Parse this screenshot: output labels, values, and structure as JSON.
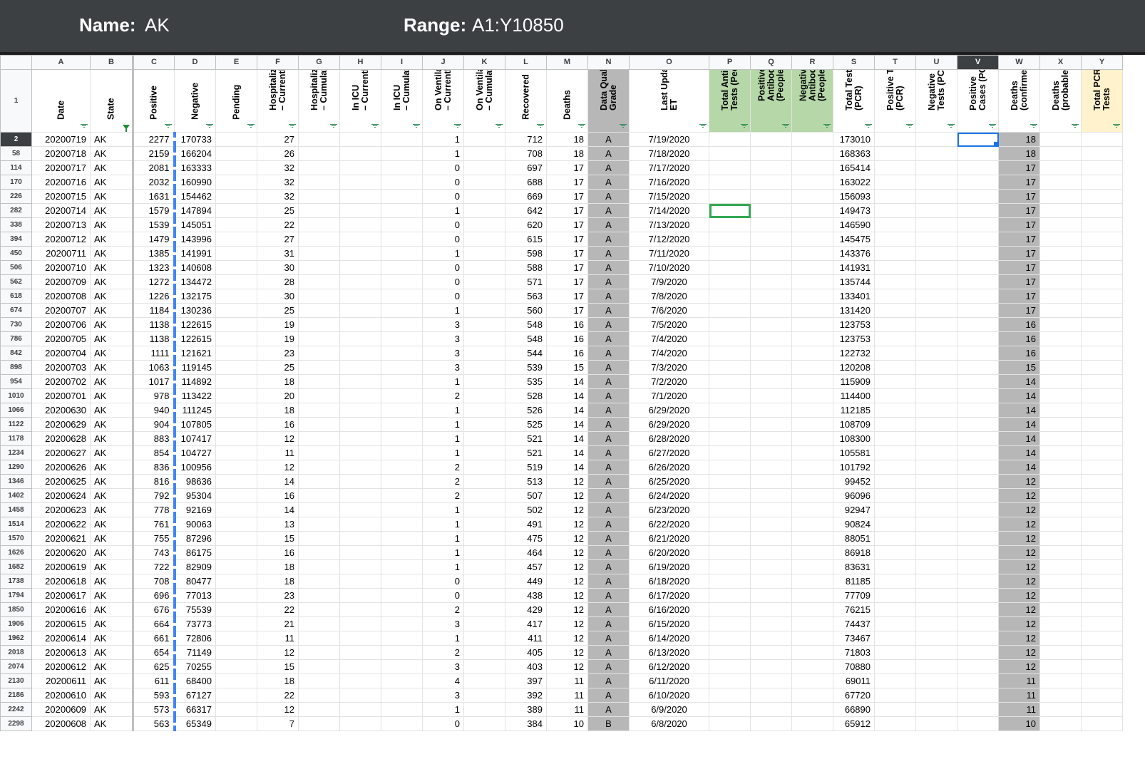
{
  "topbar": {
    "name_label": "Name:",
    "name_value": "AK",
    "range_label": "Range:",
    "range_value": "A1:Y10850"
  },
  "columns": [
    "A",
    "B",
    "C",
    "D",
    "E",
    "F",
    "G",
    "H",
    "I",
    "J",
    "K",
    "L",
    "M",
    "N",
    "O",
    "P",
    "Q",
    "R",
    "S",
    "T",
    "U",
    "V",
    "W",
    "X",
    "Y"
  ],
  "headers": [
    "Date",
    "State",
    "Positive",
    "Negative",
    "Pending",
    "Hospitalized\n– Currently",
    "Hospitalized\n– Cumulative",
    "In ICU\n– Currently",
    "In ICU\n– Cumulative",
    "On Ventilator\n– Currently",
    "On Ventilator\n– Cumulative",
    "Recovered",
    "Deaths",
    "Data Quality\nGrade",
    "Last Update\nET",
    "Total Antibody\nTests (People)",
    "Positive\nAntibody Tests\n(People)",
    "Negative\nAntibody Tests\n(People)",
    "Total Tests\n(PCR)",
    "Positive Tests\n(PCR)",
    "Negative\nTests (PCR)",
    "Positive\nCases (PCR)",
    "Deaths\n(confirmed)",
    "Deaths\n(probable)",
    "Total PCR\nTests"
  ],
  "header_row_number": "1",
  "rows": [
    {
      "n": "2",
      "date": "20200719",
      "state": "AK",
      "pos": "2277",
      "neg": "170733",
      "hosp": "27",
      "vent": "1",
      "rec": "712",
      "deaths": "18",
      "grade": "A",
      "upd": "7/19/2020",
      "tt": "173010",
      "dc": "18"
    },
    {
      "n": "58",
      "date": "20200718",
      "state": "AK",
      "pos": "2159",
      "neg": "166204",
      "hosp": "26",
      "vent": "1",
      "rec": "708",
      "deaths": "18",
      "grade": "A",
      "upd": "7/18/2020",
      "tt": "168363",
      "dc": "18"
    },
    {
      "n": "114",
      "date": "20200717",
      "state": "AK",
      "pos": "2081",
      "neg": "163333",
      "hosp": "32",
      "vent": "0",
      "rec": "697",
      "deaths": "17",
      "grade": "A",
      "upd": "7/17/2020",
      "tt": "165414",
      "dc": "17"
    },
    {
      "n": "170",
      "date": "20200716",
      "state": "AK",
      "pos": "2032",
      "neg": "160990",
      "hosp": "32",
      "vent": "0",
      "rec": "688",
      "deaths": "17",
      "grade": "A",
      "upd": "7/16/2020",
      "tt": "163022",
      "dc": "17"
    },
    {
      "n": "226",
      "date": "20200715",
      "state": "AK",
      "pos": "1631",
      "neg": "154462",
      "hosp": "32",
      "vent": "0",
      "rec": "669",
      "deaths": "17",
      "grade": "A",
      "upd": "7/15/2020",
      "tt": "156093",
      "dc": "17"
    },
    {
      "n": "282",
      "date": "20200714",
      "state": "AK",
      "pos": "1579",
      "neg": "147894",
      "hosp": "25",
      "vent": "1",
      "rec": "642",
      "deaths": "17",
      "grade": "A",
      "upd": "7/14/2020",
      "tt": "149473",
      "dc": "17"
    },
    {
      "n": "338",
      "date": "20200713",
      "state": "AK",
      "pos": "1539",
      "neg": "145051",
      "hosp": "22",
      "vent": "0",
      "rec": "620",
      "deaths": "17",
      "grade": "A",
      "upd": "7/13/2020",
      "tt": "146590",
      "dc": "17"
    },
    {
      "n": "394",
      "date": "20200712",
      "state": "AK",
      "pos": "1479",
      "neg": "143996",
      "hosp": "27",
      "vent": "0",
      "rec": "615",
      "deaths": "17",
      "grade": "A",
      "upd": "7/12/2020",
      "tt": "145475",
      "dc": "17"
    },
    {
      "n": "450",
      "date": "20200711",
      "state": "AK",
      "pos": "1385",
      "neg": "141991",
      "hosp": "31",
      "vent": "1",
      "rec": "598",
      "deaths": "17",
      "grade": "A",
      "upd": "7/11/2020",
      "tt": "143376",
      "dc": "17"
    },
    {
      "n": "506",
      "date": "20200710",
      "state": "AK",
      "pos": "1323",
      "neg": "140608",
      "hosp": "30",
      "vent": "0",
      "rec": "588",
      "deaths": "17",
      "grade": "A",
      "upd": "7/10/2020",
      "tt": "141931",
      "dc": "17"
    },
    {
      "n": "562",
      "date": "20200709",
      "state": "AK",
      "pos": "1272",
      "neg": "134472",
      "hosp": "28",
      "vent": "0",
      "rec": "571",
      "deaths": "17",
      "grade": "A",
      "upd": "7/9/2020",
      "tt": "135744",
      "dc": "17"
    },
    {
      "n": "618",
      "date": "20200708",
      "state": "AK",
      "pos": "1226",
      "neg": "132175",
      "hosp": "30",
      "vent": "0",
      "rec": "563",
      "deaths": "17",
      "grade": "A",
      "upd": "7/8/2020",
      "tt": "133401",
      "dc": "17"
    },
    {
      "n": "674",
      "date": "20200707",
      "state": "AK",
      "pos": "1184",
      "neg": "130236",
      "hosp": "25",
      "vent": "1",
      "rec": "560",
      "deaths": "17",
      "grade": "A",
      "upd": "7/6/2020",
      "tt": "131420",
      "dc": "17"
    },
    {
      "n": "730",
      "date": "20200706",
      "state": "AK",
      "pos": "1138",
      "neg": "122615",
      "hosp": "19",
      "vent": "3",
      "rec": "548",
      "deaths": "16",
      "grade": "A",
      "upd": "7/5/2020",
      "tt": "123753",
      "dc": "16"
    },
    {
      "n": "786",
      "date": "20200705",
      "state": "AK",
      "pos": "1138",
      "neg": "122615",
      "hosp": "19",
      "vent": "3",
      "rec": "548",
      "deaths": "16",
      "grade": "A",
      "upd": "7/4/2020",
      "tt": "123753",
      "dc": "16"
    },
    {
      "n": "842",
      "date": "20200704",
      "state": "AK",
      "pos": "1111",
      "neg": "121621",
      "hosp": "23",
      "vent": "3",
      "rec": "544",
      "deaths": "16",
      "grade": "A",
      "upd": "7/4/2020",
      "tt": "122732",
      "dc": "16"
    },
    {
      "n": "898",
      "date": "20200703",
      "state": "AK",
      "pos": "1063",
      "neg": "119145",
      "hosp": "25",
      "vent": "3",
      "rec": "539",
      "deaths": "15",
      "grade": "A",
      "upd": "7/3/2020",
      "tt": "120208",
      "dc": "15"
    },
    {
      "n": "954",
      "date": "20200702",
      "state": "AK",
      "pos": "1017",
      "neg": "114892",
      "hosp": "18",
      "vent": "1",
      "rec": "535",
      "deaths": "14",
      "grade": "A",
      "upd": "7/2/2020",
      "tt": "115909",
      "dc": "14"
    },
    {
      "n": "1010",
      "date": "20200701",
      "state": "AK",
      "pos": "978",
      "neg": "113422",
      "hosp": "20",
      "vent": "2",
      "rec": "528",
      "deaths": "14",
      "grade": "A",
      "upd": "7/1/2020",
      "tt": "114400",
      "dc": "14"
    },
    {
      "n": "1066",
      "date": "20200630",
      "state": "AK",
      "pos": "940",
      "neg": "111245",
      "hosp": "18",
      "vent": "1",
      "rec": "526",
      "deaths": "14",
      "grade": "A",
      "upd": "6/29/2020",
      "tt": "112185",
      "dc": "14"
    },
    {
      "n": "1122",
      "date": "20200629",
      "state": "AK",
      "pos": "904",
      "neg": "107805",
      "hosp": "16",
      "vent": "1",
      "rec": "525",
      "deaths": "14",
      "grade": "A",
      "upd": "6/29/2020",
      "tt": "108709",
      "dc": "14"
    },
    {
      "n": "1178",
      "date": "20200628",
      "state": "AK",
      "pos": "883",
      "neg": "107417",
      "hosp": "12",
      "vent": "1",
      "rec": "521",
      "deaths": "14",
      "grade": "A",
      "upd": "6/28/2020",
      "tt": "108300",
      "dc": "14"
    },
    {
      "n": "1234",
      "date": "20200627",
      "state": "AK",
      "pos": "854",
      "neg": "104727",
      "hosp": "11",
      "vent": "1",
      "rec": "521",
      "deaths": "14",
      "grade": "A",
      "upd": "6/27/2020",
      "tt": "105581",
      "dc": "14"
    },
    {
      "n": "1290",
      "date": "20200626",
      "state": "AK",
      "pos": "836",
      "neg": "100956",
      "hosp": "12",
      "vent": "2",
      "rec": "519",
      "deaths": "14",
      "grade": "A",
      "upd": "6/26/2020",
      "tt": "101792",
      "dc": "14"
    },
    {
      "n": "1346",
      "date": "20200625",
      "state": "AK",
      "pos": "816",
      "neg": "98636",
      "hosp": "14",
      "vent": "2",
      "rec": "513",
      "deaths": "12",
      "grade": "A",
      "upd": "6/25/2020",
      "tt": "99452",
      "dc": "12"
    },
    {
      "n": "1402",
      "date": "20200624",
      "state": "AK",
      "pos": "792",
      "neg": "95304",
      "hosp": "16",
      "vent": "2",
      "rec": "507",
      "deaths": "12",
      "grade": "A",
      "upd": "6/24/2020",
      "tt": "96096",
      "dc": "12"
    },
    {
      "n": "1458",
      "date": "20200623",
      "state": "AK",
      "pos": "778",
      "neg": "92169",
      "hosp": "14",
      "vent": "1",
      "rec": "502",
      "deaths": "12",
      "grade": "A",
      "upd": "6/23/2020",
      "tt": "92947",
      "dc": "12"
    },
    {
      "n": "1514",
      "date": "20200622",
      "state": "AK",
      "pos": "761",
      "neg": "90063",
      "hosp": "13",
      "vent": "1",
      "rec": "491",
      "deaths": "12",
      "grade": "A",
      "upd": "6/22/2020",
      "tt": "90824",
      "dc": "12"
    },
    {
      "n": "1570",
      "date": "20200621",
      "state": "AK",
      "pos": "755",
      "neg": "87296",
      "hosp": "15",
      "vent": "1",
      "rec": "475",
      "deaths": "12",
      "grade": "A",
      "upd": "6/21/2020",
      "tt": "88051",
      "dc": "12"
    },
    {
      "n": "1626",
      "date": "20200620",
      "state": "AK",
      "pos": "743",
      "neg": "86175",
      "hosp": "16",
      "vent": "1",
      "rec": "464",
      "deaths": "12",
      "grade": "A",
      "upd": "6/20/2020",
      "tt": "86918",
      "dc": "12"
    },
    {
      "n": "1682",
      "date": "20200619",
      "state": "AK",
      "pos": "722",
      "neg": "82909",
      "hosp": "18",
      "vent": "1",
      "rec": "457",
      "deaths": "12",
      "grade": "A",
      "upd": "6/19/2020",
      "tt": "83631",
      "dc": "12"
    },
    {
      "n": "1738",
      "date": "20200618",
      "state": "AK",
      "pos": "708",
      "neg": "80477",
      "hosp": "18",
      "vent": "0",
      "rec": "449",
      "deaths": "12",
      "grade": "A",
      "upd": "6/18/2020",
      "tt": "81185",
      "dc": "12"
    },
    {
      "n": "1794",
      "date": "20200617",
      "state": "AK",
      "pos": "696",
      "neg": "77013",
      "hosp": "23",
      "vent": "0",
      "rec": "438",
      "deaths": "12",
      "grade": "A",
      "upd": "6/17/2020",
      "tt": "77709",
      "dc": "12"
    },
    {
      "n": "1850",
      "date": "20200616",
      "state": "AK",
      "pos": "676",
      "neg": "75539",
      "hosp": "22",
      "vent": "2",
      "rec": "429",
      "deaths": "12",
      "grade": "A",
      "upd": "6/16/2020",
      "tt": "76215",
      "dc": "12"
    },
    {
      "n": "1906",
      "date": "20200615",
      "state": "AK",
      "pos": "664",
      "neg": "73773",
      "hosp": "21",
      "vent": "3",
      "rec": "417",
      "deaths": "12",
      "grade": "A",
      "upd": "6/15/2020",
      "tt": "74437",
      "dc": "12"
    },
    {
      "n": "1962",
      "date": "20200614",
      "state": "AK",
      "pos": "661",
      "neg": "72806",
      "hosp": "11",
      "vent": "1",
      "rec": "411",
      "deaths": "12",
      "grade": "A",
      "upd": "6/14/2020",
      "tt": "73467",
      "dc": "12"
    },
    {
      "n": "2018",
      "date": "20200613",
      "state": "AK",
      "pos": "654",
      "neg": "71149",
      "hosp": "12",
      "vent": "2",
      "rec": "405",
      "deaths": "12",
      "grade": "A",
      "upd": "6/13/2020",
      "tt": "71803",
      "dc": "12"
    },
    {
      "n": "2074",
      "date": "20200612",
      "state": "AK",
      "pos": "625",
      "neg": "70255",
      "hosp": "15",
      "vent": "3",
      "rec": "403",
      "deaths": "12",
      "grade": "A",
      "upd": "6/12/2020",
      "tt": "70880",
      "dc": "12"
    },
    {
      "n": "2130",
      "date": "20200611",
      "state": "AK",
      "pos": "611",
      "neg": "68400",
      "hosp": "18",
      "vent": "4",
      "rec": "397",
      "deaths": "11",
      "grade": "A",
      "upd": "6/11/2020",
      "tt": "69011",
      "dc": "11"
    },
    {
      "n": "2186",
      "date": "20200610",
      "state": "AK",
      "pos": "593",
      "neg": "67127",
      "hosp": "22",
      "vent": "3",
      "rec": "392",
      "deaths": "11",
      "grade": "A",
      "upd": "6/10/2020",
      "tt": "67720",
      "dc": "11"
    },
    {
      "n": "2242",
      "date": "20200609",
      "state": "AK",
      "pos": "573",
      "neg": "66317",
      "hosp": "12",
      "vent": "1",
      "rec": "389",
      "deaths": "11",
      "grade": "A",
      "upd": "6/9/2020",
      "tt": "66890",
      "dc": "11"
    },
    {
      "n": "2298",
      "date": "20200608",
      "state": "AK",
      "pos": "563",
      "neg": "65349",
      "hosp": "7",
      "vent": "0",
      "rec": "384",
      "deaths": "10",
      "grade": "B",
      "upd": "6/8/2020",
      "tt": "65912",
      "dc": "10"
    }
  ],
  "colors": {
    "topbar": "#3c4043",
    "grade_col": "#b7b7b7",
    "antibody_cols": "#b6d7a8",
    "pcr_total_col": "#fff2cc",
    "selection": "#1a73e8",
    "filter_icon": "#2e8b57"
  }
}
